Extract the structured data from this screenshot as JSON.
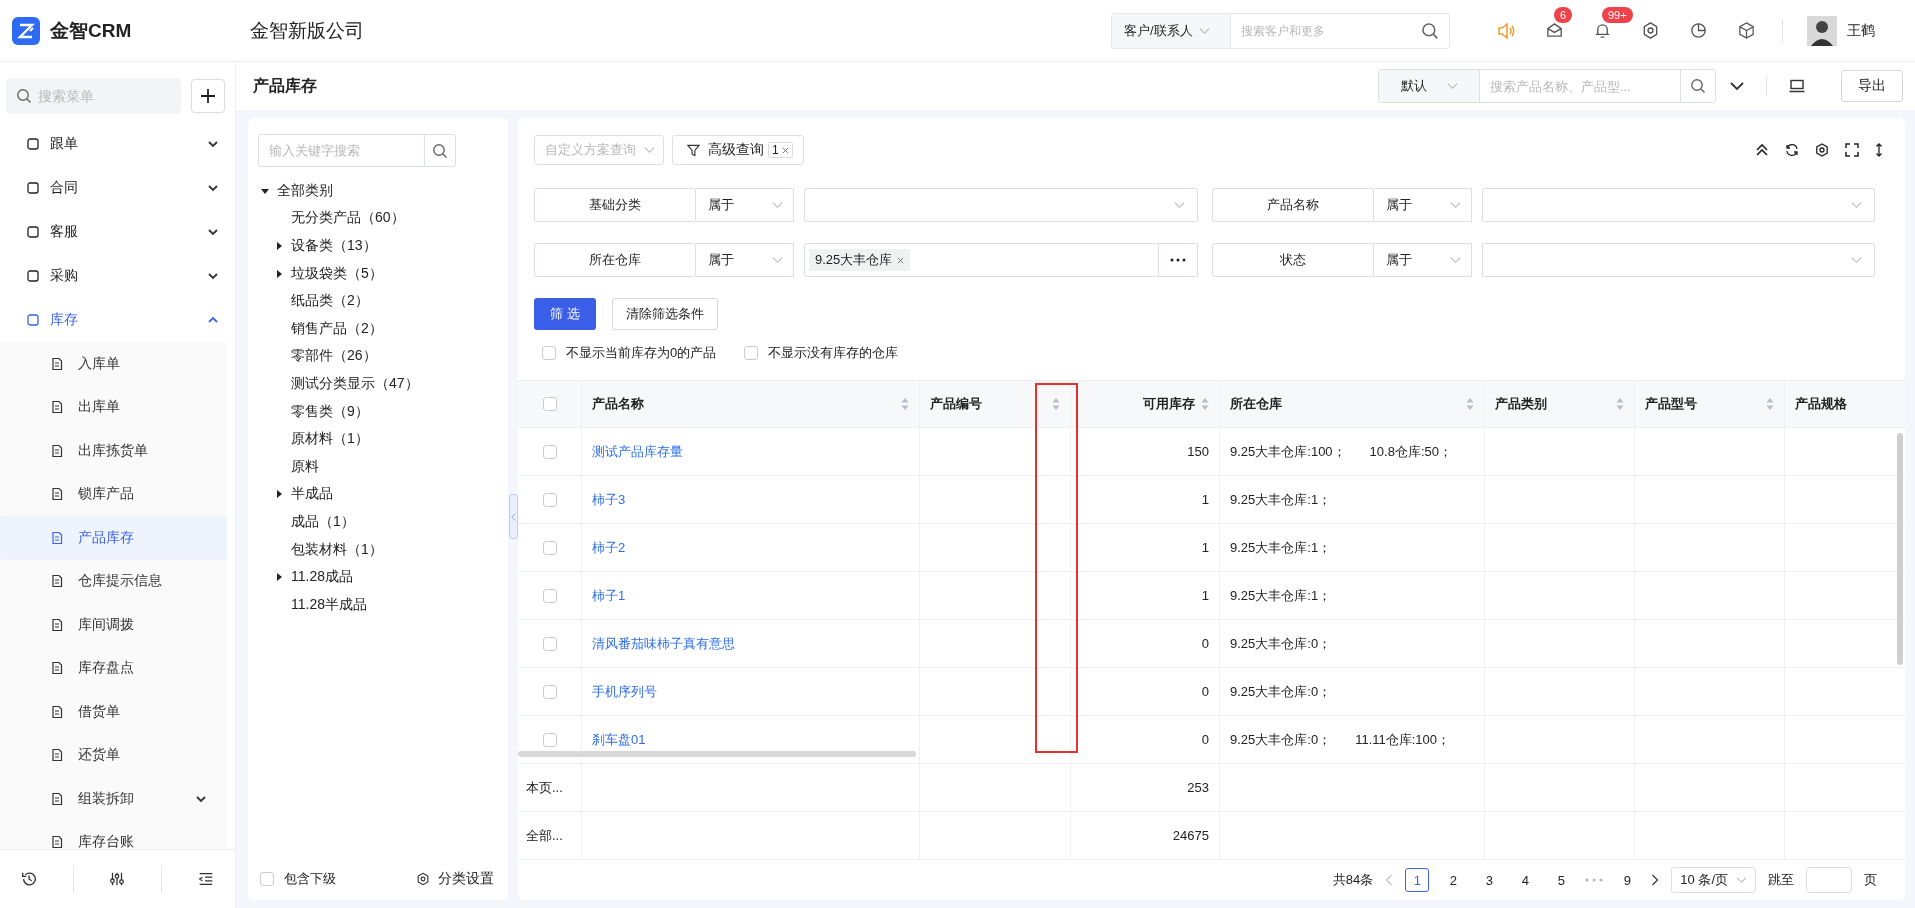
{
  "app": {
    "name": "金智CRM",
    "company": "金智新版公司"
  },
  "global_search": {
    "scope": "客户/联系人",
    "placeholder": "搜索客户和更多"
  },
  "header_icons": [
    {
      "kind": "speaker"
    },
    {
      "kind": "mail",
      "badge": "6"
    },
    {
      "kind": "bell",
      "badge": "99+"
    },
    {
      "kind": "gear"
    },
    {
      "kind": "chart"
    },
    {
      "kind": "cube"
    }
  ],
  "user": {
    "name": "王鹤"
  },
  "sidebar": {
    "search_placeholder": "搜索菜单",
    "items": [
      {
        "label": "跟单",
        "selected": false,
        "expanded": false
      },
      {
        "label": "合同",
        "selected": false,
        "expanded": false
      },
      {
        "label": "客服",
        "selected": false,
        "expanded": false
      },
      {
        "label": "采购",
        "selected": false,
        "expanded": false
      },
      {
        "label": "库存",
        "selected": true,
        "expanded": true,
        "children": [
          {
            "label": "入库单",
            "selected": false
          },
          {
            "label": "出库单",
            "selected": false
          },
          {
            "label": "出库拣货单",
            "selected": false
          },
          {
            "label": "锁库产品",
            "selected": false
          },
          {
            "label": "产品库存",
            "selected": true
          },
          {
            "label": "仓库提示信息",
            "selected": false
          },
          {
            "label": "库间调拨",
            "selected": false
          },
          {
            "label": "库存盘点",
            "selected": false
          },
          {
            "label": "借货单",
            "selected": false
          },
          {
            "label": "还货单",
            "selected": false
          },
          {
            "label": "组装拆卸",
            "selected": false,
            "expanded": false
          },
          {
            "label": "库存台账",
            "selected": false
          }
        ]
      }
    ]
  },
  "page_header": {
    "title": "产品库存",
    "view": "默认",
    "search_placeholder": "搜索产品名称、产品型...",
    "export": "导出"
  },
  "category_tree": {
    "search_placeholder": "输入关键字搜索",
    "root": {
      "label": "全部类别",
      "expanded": true,
      "children": [
        {
          "label": "无分类产品（60）"
        },
        {
          "label": "设备类（13）",
          "expanded": false
        },
        {
          "label": "垃圾袋类（5）",
          "expanded": false
        },
        {
          "label": "纸品类（2）"
        },
        {
          "label": "销售产品（2）"
        },
        {
          "label": "零部件（26）"
        },
        {
          "label": "测试分类显示（47）"
        },
        {
          "label": "零售类（9）"
        },
        {
          "label": "原材料（1）"
        },
        {
          "label": "原料"
        },
        {
          "label": "半成品",
          "expanded": false
        },
        {
          "label": "成品（1）"
        },
        {
          "label": "包装材料（1）"
        },
        {
          "label": "11.28成品",
          "expanded": false
        },
        {
          "label": "11.28半成品"
        }
      ]
    },
    "include_children": {
      "label": "包含下级",
      "checked": false
    },
    "settings": "分类设置"
  },
  "query": {
    "scheme_placeholder": "自定义方案查询",
    "advanced": "高级查询",
    "advanced_count": "1"
  },
  "filters": [
    {
      "field": "基础分类",
      "operator": "属于"
    },
    {
      "field": "产品名称",
      "operator": "属于"
    },
    {
      "field": "所在仓库",
      "operator": "属于",
      "tags": [
        "9.25大丰仓库"
      ],
      "more": true
    },
    {
      "field": "状态",
      "operator": "属于"
    }
  ],
  "filter_buttons": {
    "apply": "筛 选",
    "clear": "清除筛选条件"
  },
  "options": [
    {
      "label": "不显示当前库存为0的产品",
      "checked": false
    },
    {
      "label": "不显示没有库存的仓库",
      "checked": false
    }
  ],
  "table": {
    "select_all": {
      "checked": false
    },
    "columns": [
      {
        "label": "产品名称",
        "sortable": true
      },
      {
        "label": "产品编号",
        "sortable": true
      },
      {
        "label": "可用库存",
        "sortable": true
      },
      {
        "label": "所在仓库",
        "sortable": true
      },
      {
        "label": "产品类别",
        "sortable": true
      },
      {
        "label": "产品型号",
        "sortable": true
      },
      {
        "label": "产品规格",
        "sortable": false
      }
    ],
    "rows": [
      {
        "checked": false,
        "name": "测试产品库存量",
        "stock": "150",
        "warehouses": [
          "9.25大丰仓库:100；",
          "10.8仓库:50；"
        ]
      },
      {
        "checked": false,
        "name": "柿子3",
        "stock": "1",
        "warehouses": [
          "9.25大丰仓库:1；"
        ]
      },
      {
        "checked": false,
        "name": "柿子2",
        "stock": "1",
        "warehouses": [
          "9.25大丰仓库:1；"
        ]
      },
      {
        "checked": false,
        "name": "柿子1",
        "stock": "1",
        "warehouses": [
          "9.25大丰仓库:1；"
        ]
      },
      {
        "checked": false,
        "name": "清风番茄味柿子真有意思",
        "stock": "0",
        "warehouses": [
          "9.25大丰仓库:0；"
        ]
      },
      {
        "checked": false,
        "name": "手机序列号",
        "stock": "0",
        "warehouses": [
          "9.25大丰仓库:0；"
        ]
      },
      {
        "checked": false,
        "name": "刹车盘01",
        "stock": "0",
        "warehouses": [
          "9.25大丰仓库:0；",
          "11.11仓库:100；"
        ]
      }
    ],
    "summary": [
      {
        "label": "本页...",
        "stock": "253"
      },
      {
        "label": "全部...",
        "stock": "24675"
      }
    ]
  },
  "pagination": {
    "total": "共84条",
    "prev": {
      "disabled": true
    },
    "next": {
      "disabled": false
    },
    "pages": [
      {
        "kind": "page",
        "label": "1",
        "selected": true
      },
      {
        "kind": "page",
        "label": "2",
        "selected": false
      },
      {
        "kind": "page",
        "label": "3",
        "selected": false
      },
      {
        "kind": "page",
        "label": "4",
        "selected": false
      },
      {
        "kind": "page",
        "label": "5",
        "selected": false
      },
      {
        "kind": "ellipsis"
      },
      {
        "kind": "page",
        "label": "9",
        "selected": false
      }
    ],
    "page_size": "10 条/页",
    "jump_label": "跳至",
    "jump_suffix": "页"
  }
}
